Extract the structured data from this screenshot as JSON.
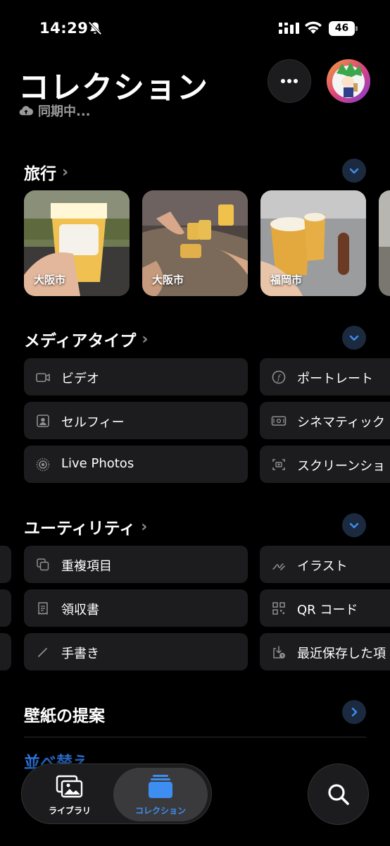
{
  "status_bar": {
    "time": "14:29",
    "battery": "46"
  },
  "header": {
    "title": "コレクション",
    "sync_status": "同期中..."
  },
  "sections": {
    "trips": {
      "title": "旅行",
      "cards": [
        {
          "label": "大阪市"
        },
        {
          "label": "大阪市"
        },
        {
          "label": "福岡市"
        }
      ]
    },
    "media_types": {
      "title": "メディアタイプ",
      "items": [
        {
          "label": "ビデオ",
          "icon": "video-icon"
        },
        {
          "label": "ポートレート",
          "icon": "portrait-icon"
        },
        {
          "label": "セルフィー",
          "icon": "selfie-icon"
        },
        {
          "label": "シネマティック",
          "icon": "cinematic-icon"
        },
        {
          "label": "Live Photos",
          "icon": "live-photos-icon"
        },
        {
          "label": "スクリーンショ",
          "icon": "screenshot-icon"
        }
      ]
    },
    "utilities": {
      "title": "ユーティリティ",
      "items": [
        {
          "label": "重複項目",
          "icon": "duplicates-icon"
        },
        {
          "label": "イラスト",
          "icon": "illustration-icon"
        },
        {
          "label": "領収書",
          "icon": "receipt-icon"
        },
        {
          "label": "QR コード",
          "icon": "qr-code-icon"
        },
        {
          "label": "手書き",
          "icon": "handwriting-icon"
        },
        {
          "label": "最近保存した項",
          "icon": "recently-saved-icon"
        }
      ]
    },
    "wallpaper": {
      "title": "壁紙の提案"
    },
    "sort": {
      "label": "並べ替え"
    }
  },
  "tab_bar": {
    "library": "ライブラリ",
    "collection": "コレクション"
  },
  "colors": {
    "accent": "#2f7ae5",
    "background": "#000000",
    "tile": "#1c1c1e"
  }
}
